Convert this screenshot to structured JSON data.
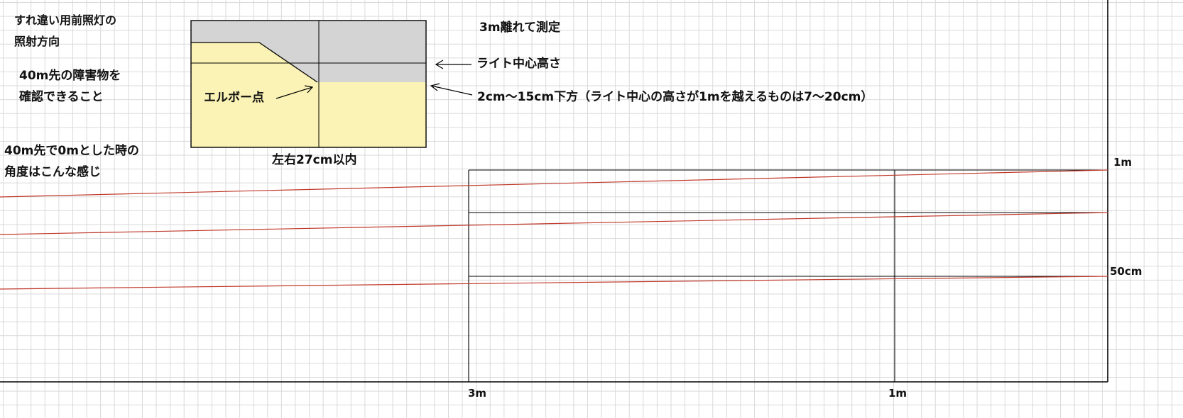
{
  "texts": {
    "direction_title_line1": "すれ違い用前照灯の",
    "direction_title_line2": "照射方向",
    "obstacle_line1": "40m先の障害物を",
    "obstacle_line2": "確認できること",
    "angle_line1": "40m先で0mとした時の",
    "angle_line2": "角度はこんな感じ",
    "measure_note": "3m離れて測定",
    "light_center": "ライト中心高さ",
    "elbow_point": "エルボー点",
    "lower_range": "2cm～15cm下方（ライト中心の高さが1mを越えるものは7～20cm）",
    "left_right": "左右27cm以内"
  },
  "axis_labels": {
    "x_3m": "3m",
    "x_1m": "1m",
    "y_1m": "1m",
    "y_50cm": "50cm"
  },
  "colors": {
    "upper_region": "#d4d4d4",
    "lower_region": "#fbf3b5",
    "red_lines": "#c0392b",
    "frame": "#000000",
    "grid": "#d9d9d9"
  }
}
